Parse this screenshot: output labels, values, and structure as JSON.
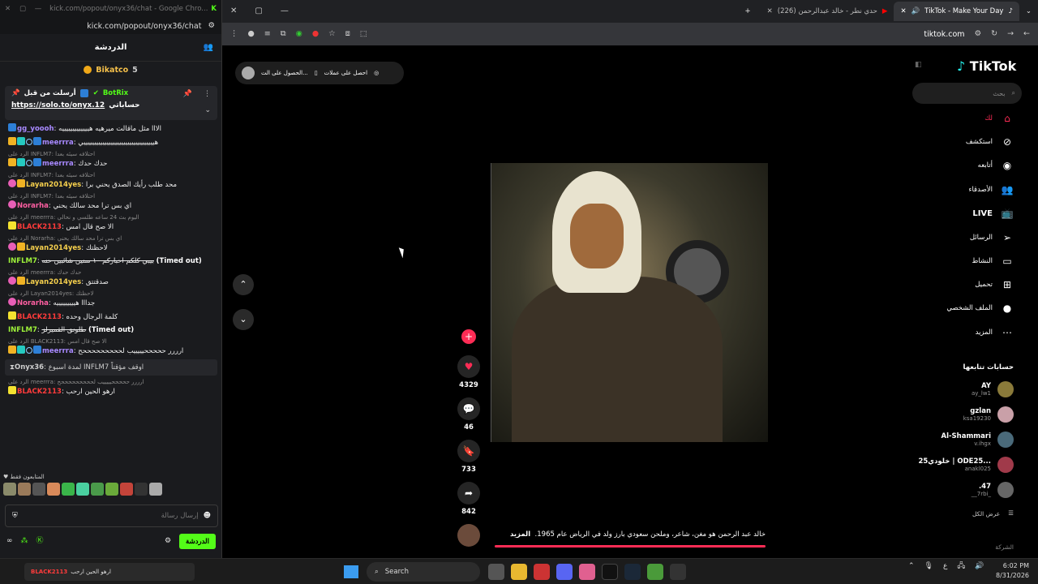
{
  "chat_window": {
    "title": "kick.com/popout/onyx36/chat - Google Chro...",
    "url": "kick.com/popout/onyx36/chat",
    "header": "الدردشة",
    "gift_user": "Bikatco",
    "gift_count": "5",
    "pinned": {
      "prefix": "أرسلت من قبل",
      "bot": "BotRix",
      "link": "https://solo.to/onyx.12",
      "link_label": "حساباتي"
    },
    "messages": [
      {
        "badges": [
          "gift"
        ],
        "user": "gg_yoooh",
        "cls": "u-purple",
        "text": "الااا مثل ماقالت ميرهيه هيييييييييييييه"
      },
      {
        "badges": [
          "crown",
          "sub",
          "dia",
          "gift"
        ],
        "user": "meerrra",
        "cls": "u-purple",
        "text": "هييييييييييييييييييييييييييييييييييي"
      },
      {
        "reply": "الرد على INFLM7: احتلافه سيئه بعدا",
        "badges": [
          "crown",
          "sub",
          "dia",
          "gift"
        ],
        "user": "meerrra",
        "cls": "u-purple",
        "text": "حدك حدك"
      },
      {
        "reply": "الرد على INFLM7: احتلافه سيئه بعدا",
        "badges": [
          "vip",
          "crown"
        ],
        "user": "Layan2014yes",
        "cls": "u-yellow",
        "text": "محد طلب رأيك الصدق يحني برا"
      },
      {
        "reply": "الرد على INFLM7: احتلافه سيئه بعدا",
        "badges": [
          "vip"
        ],
        "user": "Norarha",
        "cls": "u-pink",
        "text": "اي بس ترا محد سالك يحني"
      },
      {
        "reply": "الرد على meerrra: اليوم بث 24 ساعه طلسي و نحالي",
        "badges": [
          "num"
        ],
        "user": "BLACK2113",
        "cls": "u-red",
        "text": "الا صح قال امس"
      },
      {
        "reply": "الرد على Norarha: اي بس ترا محد سالك يحني",
        "badges": [
          "vip",
          "crown"
        ],
        "user": "Layan2014yes",
        "cls": "u-yellow",
        "text": "لاحظتك"
      },
      {
        "badges": [],
        "user": "INFLM7",
        "cls": "u-green",
        "text": "بيبي كلكم احباركم ١٠ سنين شائبين حنه",
        "timed": "(Timed out)"
      },
      {
        "reply": "الرد على meerrra: حدك حدك",
        "badges": [
          "vip",
          "crown"
        ],
        "user": "Layan2014yes",
        "cls": "u-yellow",
        "text": "صدقتتق"
      },
      {
        "reply": "الرد على Layan2014yes: لاحظتك",
        "badges": [
          "vip"
        ],
        "user": "Norarha",
        "cls": "u-pink",
        "text": "جدااا هيييييييييه"
      },
      {
        "badges": [
          "num"
        ],
        "user": "BLACK2113",
        "cls": "u-red",
        "text": "كلمة الرجال وحده"
      },
      {
        "badges": [],
        "user": "INFLM7",
        "cls": "u-green",
        "text": "طلونق القميرلز",
        "timed": "(Timed out)"
      },
      {
        "reply": "الرد على BLACK2113: الا صح قال امس",
        "badges": [
          "crown",
          "sub",
          "dia",
          "gift"
        ],
        "user": "meerrra",
        "cls": "u-purple",
        "text": "ارررر حححححيييييب لحححححححححح"
      },
      {
        "system": true,
        "user": "Onyx36",
        "text": "لمدة اسبوع INFLM7 اوقف مؤقتاً"
      },
      {
        "reply": "الرد على meerrra: ارررر حححححيييييب لحححححححححح",
        "badges": [
          "num"
        ],
        "user": "BLACK2113",
        "cls": "u-red",
        "text": "ارهو الحين ارحب"
      }
    ],
    "emotes_label": "المتابعون فقط",
    "input_placeholder": "إرسال رسالة",
    "send_label": "الدردشة"
  },
  "browser": {
    "tabs": [
      {
        "label": "TikTok - Make Your Day",
        "active": true
      },
      {
        "label": "(226) حدي نطر - خالد عبدالرحمن",
        "active": false
      }
    ],
    "url": "tiktok.com"
  },
  "tiktok": {
    "top_buttons": [
      "احصل على عملات",
      "الحصول على الت..."
    ],
    "actions": {
      "likes": "4329",
      "comments": "46",
      "saves": "733",
      "shares": "842"
    },
    "caption": "خالد عبد الرحمن هو مغن، شاعر، وملحن سعودي بارز ولد في الرياض عام 1965.",
    "caption_more": "المزيد",
    "logo": "TikTok",
    "search_placeholder": "بحث",
    "nav": [
      "لك",
      "استكشف",
      "أتابعه",
      "الأصدقاء",
      "LIVE",
      "الرسائل",
      "النشاط",
      "تحميل",
      "الملف الشخصي",
      "المزيد"
    ],
    "following_title": "حسابات تتابعها",
    "accounts": [
      {
        "name": "AY",
        "handle": "ay_lw1"
      },
      {
        "name": "gzlan",
        "handle": "ksa19230"
      },
      {
        "name": "Al-Shammari",
        "handle": "v.ihgx"
      },
      {
        "name": "خلودي25 | ODE25...",
        "handle": "anakl025"
      },
      {
        "name": ".47",
        "handle": "__7rbi_"
      }
    ],
    "see_all": "عرض الكل",
    "company": "الشركة"
  },
  "taskbar": {
    "notif_user": "BLACK2113",
    "notif_text": "ارهو الحين ارحب",
    "search": "Search",
    "time": "6:02 PM",
    "date": "8/31/2026",
    "lang": "ع"
  }
}
